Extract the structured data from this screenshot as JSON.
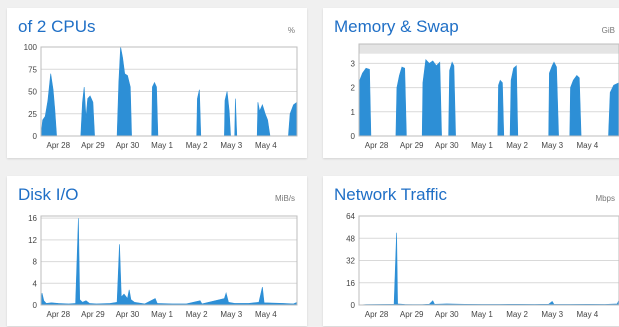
{
  "cards": [
    {
      "title": "of 2 CPUs",
      "unit": "%",
      "chart_data": {
        "type": "area",
        "x_labels": [
          "Apr 28",
          "Apr 29",
          "Apr 30",
          "May 1",
          "May 2",
          "May 3",
          "May 4"
        ],
        "y_ticks": [
          0,
          25,
          50,
          75,
          100
        ],
        "ylim": [
          0,
          100
        ],
        "xlim_days": [
          0,
          7.4
        ],
        "points": [
          [
            0,
            0
          ],
          [
            0.05,
            18
          ],
          [
            0.12,
            22
          ],
          [
            0.2,
            40
          ],
          [
            0.28,
            70
          ],
          [
            0.35,
            52
          ],
          [
            0.4,
            30
          ],
          [
            0.45,
            0
          ],
          [
            1.15,
            0
          ],
          [
            1.2,
            38
          ],
          [
            1.25,
            55
          ],
          [
            1.3,
            20
          ],
          [
            1.35,
            42
          ],
          [
            1.42,
            45
          ],
          [
            1.5,
            38
          ],
          [
            1.55,
            0
          ],
          [
            2.2,
            0
          ],
          [
            2.25,
            60
          ],
          [
            2.3,
            100
          ],
          [
            2.36,
            88
          ],
          [
            2.42,
            70
          ],
          [
            2.5,
            68
          ],
          [
            2.58,
            55
          ],
          [
            2.62,
            0
          ],
          [
            3.2,
            0
          ],
          [
            3.22,
            55
          ],
          [
            3.28,
            60
          ],
          [
            3.34,
            55
          ],
          [
            3.38,
            0
          ],
          [
            4.5,
            0
          ],
          [
            4.52,
            42
          ],
          [
            4.58,
            52
          ],
          [
            4.62,
            0
          ],
          [
            5.3,
            0
          ],
          [
            5.32,
            40
          ],
          [
            5.38,
            50
          ],
          [
            5.44,
            28
          ],
          [
            5.48,
            0
          ],
          [
            5.6,
            0
          ],
          [
            5.62,
            42
          ],
          [
            5.66,
            0
          ],
          [
            6.25,
            0
          ],
          [
            6.27,
            38
          ],
          [
            6.32,
            28
          ],
          [
            6.4,
            35
          ],
          [
            6.48,
            25
          ],
          [
            6.55,
            18
          ],
          [
            6.62,
            0
          ],
          [
            7.15,
            0
          ],
          [
            7.2,
            25
          ],
          [
            7.3,
            35
          ],
          [
            7.4,
            38
          ]
        ]
      }
    },
    {
      "title": "Memory & Swap",
      "unit": "GiB",
      "chart_data": {
        "type": "area",
        "x_labels": [
          "Apr 28",
          "Apr 29",
          "Apr 30",
          "May 1",
          "May 2",
          "May 3",
          "May 4"
        ],
        "y_ticks": [
          0,
          1,
          2,
          3
        ],
        "ylim": [
          0,
          3.8
        ],
        "xlim_days": [
          0,
          7.4
        ],
        "swap_band": [
          3.4,
          3.8
        ],
        "points": [
          [
            0,
            0
          ],
          [
            0.02,
            2.3
          ],
          [
            0.1,
            2.6
          ],
          [
            0.2,
            2.8
          ],
          [
            0.3,
            2.75
          ],
          [
            0.34,
            0
          ],
          [
            1.05,
            0
          ],
          [
            1.08,
            2.0
          ],
          [
            1.15,
            2.5
          ],
          [
            1.22,
            2.85
          ],
          [
            1.3,
            2.8
          ],
          [
            1.35,
            0
          ],
          [
            1.8,
            0
          ],
          [
            1.82,
            2.2
          ],
          [
            1.9,
            3.15
          ],
          [
            2.0,
            3.0
          ],
          [
            2.1,
            3.1
          ],
          [
            2.2,
            2.9
          ],
          [
            2.3,
            3.05
          ],
          [
            2.35,
            0
          ],
          [
            2.55,
            0
          ],
          [
            2.58,
            2.7
          ],
          [
            2.65,
            3.05
          ],
          [
            2.7,
            2.9
          ],
          [
            2.75,
            0
          ],
          [
            3.95,
            0
          ],
          [
            3.97,
            2.1
          ],
          [
            4.02,
            2.3
          ],
          [
            4.08,
            2.2
          ],
          [
            4.12,
            0
          ],
          [
            4.3,
            0
          ],
          [
            4.33,
            2.3
          ],
          [
            4.4,
            2.8
          ],
          [
            4.48,
            2.9
          ],
          [
            4.52,
            0
          ],
          [
            5.4,
            0
          ],
          [
            5.42,
            2.6
          ],
          [
            5.5,
            2.9
          ],
          [
            5.55,
            3.05
          ],
          [
            5.62,
            2.85
          ],
          [
            5.68,
            0
          ],
          [
            6.0,
            0
          ],
          [
            6.02,
            2.0
          ],
          [
            6.1,
            2.3
          ],
          [
            6.2,
            2.5
          ],
          [
            6.27,
            2.4
          ],
          [
            6.32,
            0
          ],
          [
            7.1,
            0
          ],
          [
            7.15,
            1.8
          ],
          [
            7.25,
            2.1
          ],
          [
            7.4,
            2.2
          ]
        ]
      }
    },
    {
      "title": "Disk I/O",
      "unit": "MiB/s",
      "chart_data": {
        "type": "area",
        "x_labels": [
          "Apr 28",
          "Apr 29",
          "Apr 30",
          "May 1",
          "May 2",
          "May 3",
          "May 4"
        ],
        "y_ticks": [
          0,
          4,
          8,
          12,
          16
        ],
        "ylim": [
          0,
          16.4
        ],
        "xlim_days": [
          0,
          7.4
        ],
        "points": [
          [
            0,
            0
          ],
          [
            0.03,
            2.2
          ],
          [
            0.08,
            0.8
          ],
          [
            0.15,
            0.3
          ],
          [
            0.3,
            0.4
          ],
          [
            0.5,
            0.3
          ],
          [
            0.8,
            0.2
          ],
          [
            1.0,
            0.3
          ],
          [
            1.08,
            16
          ],
          [
            1.12,
            1.0
          ],
          [
            1.2,
            0.5
          ],
          [
            1.3,
            0.8
          ],
          [
            1.4,
            0.3
          ],
          [
            1.6,
            0.2
          ],
          [
            2.0,
            0.3
          ],
          [
            2.2,
            0.5
          ],
          [
            2.27,
            11.2
          ],
          [
            2.32,
            1.5
          ],
          [
            2.4,
            2.0
          ],
          [
            2.5,
            1.2
          ],
          [
            2.55,
            2.8
          ],
          [
            2.6,
            1.0
          ],
          [
            2.7,
            0.5
          ],
          [
            3.0,
            0.2
          ],
          [
            3.3,
            1.2
          ],
          [
            3.36,
            0.3
          ],
          [
            3.8,
            0.2
          ],
          [
            4.2,
            0.2
          ],
          [
            4.6,
            0.8
          ],
          [
            4.65,
            0.2
          ],
          [
            5.3,
            1.2
          ],
          [
            5.35,
            2.2
          ],
          [
            5.42,
            0.5
          ],
          [
            5.6,
            0.3
          ],
          [
            6.0,
            0.3
          ],
          [
            6.3,
            0.5
          ],
          [
            6.4,
            3.3
          ],
          [
            6.45,
            0.4
          ],
          [
            7.0,
            0.3
          ],
          [
            7.3,
            0.2
          ],
          [
            7.4,
            0.5
          ]
        ]
      }
    },
    {
      "title": "Network Traffic",
      "unit": "Mbps",
      "chart_data": {
        "type": "area",
        "x_labels": [
          "Apr 28",
          "Apr 29",
          "Apr 30",
          "May 1",
          "May 2",
          "May 3",
          "May 4"
        ],
        "y_ticks": [
          0,
          16,
          32,
          48,
          64
        ],
        "ylim": [
          0,
          64
        ],
        "xlim_days": [
          0,
          7.4
        ],
        "points": [
          [
            0,
            0
          ],
          [
            0.2,
            0.3
          ],
          [
            0.8,
            0.4
          ],
          [
            1.0,
            0.5
          ],
          [
            1.07,
            52
          ],
          [
            1.1,
            0.8
          ],
          [
            1.3,
            0.4
          ],
          [
            1.8,
            0.3
          ],
          [
            2.0,
            0.6
          ],
          [
            2.1,
            3
          ],
          [
            2.15,
            0.5
          ],
          [
            2.5,
            0.8
          ],
          [
            3.0,
            0.5
          ],
          [
            3.5,
            0.4
          ],
          [
            4.0,
            0.4
          ],
          [
            4.5,
            0.5
          ],
          [
            5.0,
            0.4
          ],
          [
            5.4,
            0.6
          ],
          [
            5.5,
            2.5
          ],
          [
            5.55,
            0.4
          ],
          [
            6.0,
            0.4
          ],
          [
            6.5,
            0.5
          ],
          [
            7.0,
            0.4
          ],
          [
            7.35,
            0.8
          ],
          [
            7.4,
            3.5
          ]
        ]
      }
    }
  ]
}
